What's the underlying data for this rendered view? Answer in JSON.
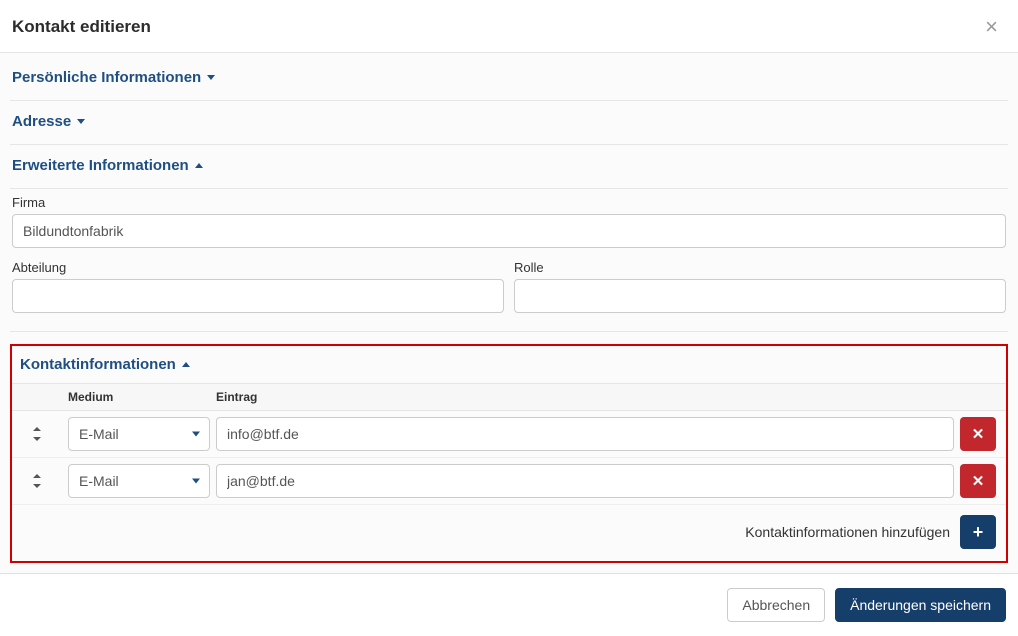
{
  "modal": {
    "title": "Kontakt editieren"
  },
  "sections": {
    "personal": {
      "title": "Persönliche Informationen",
      "expanded": false
    },
    "address": {
      "title": "Adresse",
      "expanded": false
    },
    "extended": {
      "title": "Erweiterte Informationen",
      "expanded": true
    },
    "contactinfo": {
      "title": "Kontaktinformationen",
      "expanded": true
    }
  },
  "extended": {
    "company_label": "Firma",
    "company_value": "Bildundtonfabrik",
    "department_label": "Abteilung",
    "department_value": "",
    "role_label": "Rolle",
    "role_value": ""
  },
  "contactinfo": {
    "col_medium": "Medium",
    "col_entry": "Eintrag",
    "rows": [
      {
        "medium": "E-Mail",
        "entry": "info@btf.de"
      },
      {
        "medium": "E-Mail",
        "entry": "jan@btf.de"
      }
    ],
    "add_label": "Kontaktinformationen hinzufügen"
  },
  "footer": {
    "cancel": "Abbrechen",
    "save": "Änderungen speichern"
  }
}
